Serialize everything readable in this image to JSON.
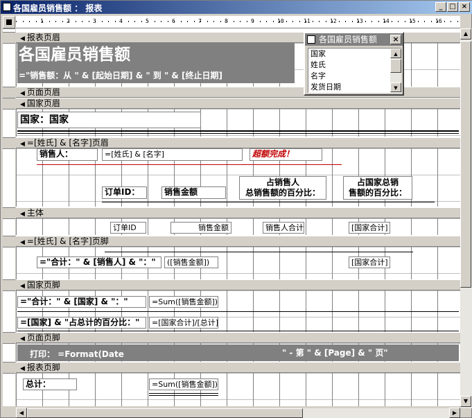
{
  "window": {
    "title": "各国雇员销售额 ： 报表"
  },
  "ruler": {
    "numbers": [
      "1",
      "2",
      "3",
      "4",
      "5",
      "6",
      "7",
      "8",
      "9",
      "10",
      "11",
      "12",
      "13",
      "14",
      "15",
      "16"
    ]
  },
  "sections": {
    "report_header": "报表页眉",
    "page_header": "页面页眉",
    "country_header": "国家页眉",
    "name_header": "=[姓氏] & [名字]页眉",
    "detail": "主体",
    "name_footer": "=[姓氏] & [名字]页脚",
    "country_footer": "国家页脚",
    "page_footer": "页面页脚",
    "report_footer": "报表页脚"
  },
  "report_header": {
    "title": "各国雇员销售额",
    "subtitle": "=\"销售额：从 \" & [起始日期] & \" 到 \" & [终止日期]"
  },
  "country_header": {
    "label": "国家：国家"
  },
  "name_header": {
    "salesperson_label": "销售人：",
    "name_expr": "=[姓氏] & [名字]",
    "exceeded_goal": "超额完成！",
    "order_id_label": "订单ID：",
    "sales_amount_label": "销售金额",
    "pct_total_label_1": "占销售人",
    "pct_total_label_2": "总销售额的百分比：",
    "pct_country_label_1": "占国家总销",
    "pct_country_label_2": "售额的百分比："
  },
  "detail": {
    "order_id": "订单ID",
    "sales_amount": "销售金额",
    "salesperson_total": "销售人合计]",
    "country_total": "[国家合计]"
  },
  "name_footer": {
    "total_expr": "=\"合计：\" & [销售人] & \"：\"",
    "sum_field": "([销售金额])",
    "country_total": "[国家合计]"
  },
  "country_footer": {
    "total_expr": "=\"合计：\" & [国家] & \"：\"",
    "sum": "=Sum([销售金额])",
    "pct_expr": "=[国家] & \"占总计的百分比：\"",
    "pct_value": "=[国家合计]/[总计]"
  },
  "page_footer": {
    "print_expr": "打印：  =Format(Date",
    "page_expr": "\" -  第 \" & [Page] & \" 页\""
  },
  "report_footer": {
    "total_label": "总计：",
    "sum": "=Sum([销售金额])"
  },
  "field_list": {
    "title": "各国雇员销售额",
    "items": [
      "国家",
      "姓氏",
      "名字",
      "发货日期"
    ]
  }
}
